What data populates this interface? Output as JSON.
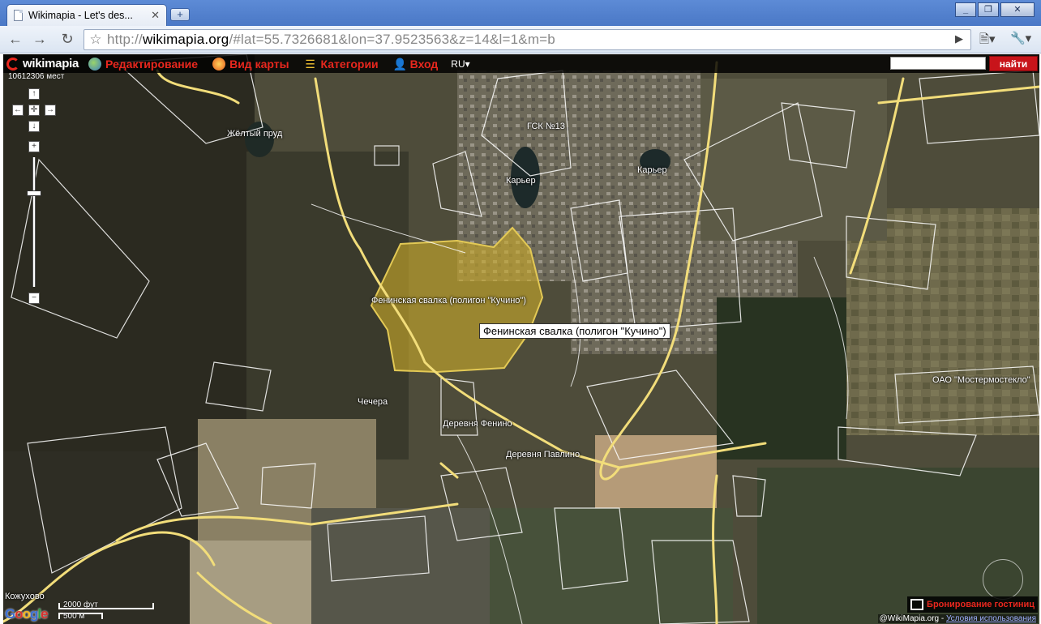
{
  "browser": {
    "tab_title": "Wikimapia - Let's des...",
    "tab_close": "✕",
    "new_tab": "+",
    "url_scheme": "http://",
    "url_host": "wikimapia.org",
    "url_path": "/#lat=55.7326681&lon=37.9523563&z=14&l=1&m=b",
    "back": "←",
    "forward": "→",
    "reload": "↻",
    "star": "☆",
    "go": "▶",
    "page_menu": "🗎▾",
    "tools_menu": "🔧▾",
    "minimize": "_",
    "restore": "❐",
    "close": "✕"
  },
  "wikimapia": {
    "logo": "wikimapia",
    "menu": [
      {
        "label": "Редактирование",
        "icon": "edit-globe-icon"
      },
      {
        "label": "Вид карты",
        "icon": "map-view-icon"
      },
      {
        "label": "Категории",
        "icon": "categories-icon"
      },
      {
        "label": "Вход",
        "icon": "user-icon"
      }
    ],
    "lang": "RU▾",
    "find_label": "найти",
    "search_value": "",
    "online_count": "10612306 мест"
  },
  "controls": {
    "up": "↑",
    "down": "↓",
    "left": "←",
    "right": "→",
    "center": "✛",
    "zoom_in": "+",
    "zoom_out": "−"
  },
  "map_labels": {
    "pond": "Жёлтый пруд",
    "gsk": "ГСК №13",
    "quarry1": "Карьер",
    "quarry2": "Карьер",
    "dump": "Фенинская свалка (полигон \"Кучино\")",
    "chechera": "Чечера",
    "fenino": "Деревня Фенино",
    "pavlino": "Деревня Павлино",
    "oao": "ОАО \"Мостермостекло\"",
    "kozhuhovo": "Кожухово"
  },
  "tooltip": "Фенинская свалка (полигон \"Кучино\")",
  "bottom": {
    "hotel": "Бронирование гостиниц",
    "copyright": "@WikiMapia.org - ",
    "terms": "Условия использования",
    "scale_ft": "2000 фут",
    "scale_m": "500 м",
    "google": [
      "G",
      "o",
      "o",
      "g",
      "l",
      "e"
    ]
  },
  "colors": {
    "accent_red": "#e8271e",
    "road_yellow": "#f2dd7a",
    "highlight_fill": "#c9a92a"
  }
}
